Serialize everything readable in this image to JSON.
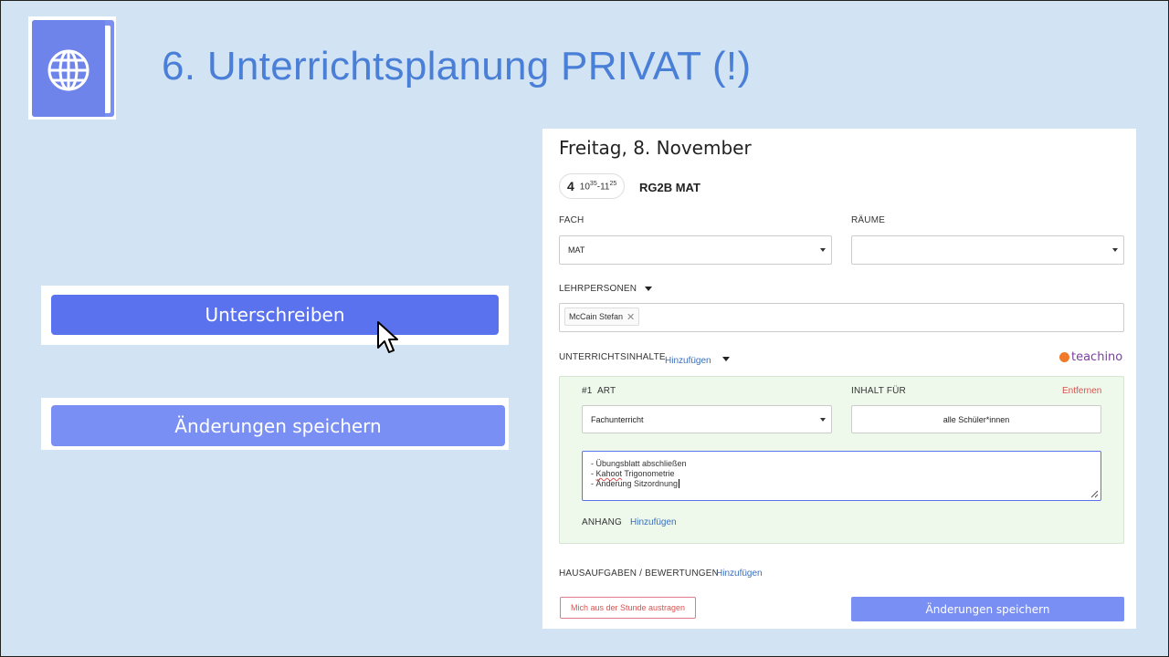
{
  "slide": {
    "title": "6. Unterrichtsplanung PRIVAT (!)",
    "colors": {
      "background": "#d2e3f3",
      "title": "#4a7fd8",
      "accent": "#5b72ee"
    }
  },
  "left_buttons": {
    "sign_label": "Unterschreiben",
    "save_label": "Änderungen speichern"
  },
  "panel": {
    "date": "Freitag, 8. November",
    "period": {
      "number": "4",
      "start_h": "10",
      "start_m": "35",
      "sep": "-",
      "end_h": "11",
      "end_m": "25"
    },
    "class_label": "RG2B MAT",
    "fach_label": "FACH",
    "fach_value": "MAT",
    "raeume_label": "RÄUME",
    "raeume_value": "",
    "lehrpersonen_label": "LEHRPERSONEN",
    "teacher_chip": "McCain Stefan",
    "chip_remove": "✕",
    "unterrichtsinhalte_label": "UNTERRICHTSINHALTE",
    "add_link": "Hinzufügen",
    "brand": "teachino",
    "content": {
      "index": "#1",
      "art_label": "ART",
      "inhalt_label": "INHALT FÜR",
      "remove_link": "Entfernen",
      "art_value": "Fachunterricht",
      "inhalt_value": "alle Schüler*innen",
      "notes": [
        "- Übungsblatt abschließen",
        "- Kahoot Trigonometrie",
        "- Änderung Sitzordnung"
      ],
      "anhang_label": "ANHANG",
      "anhang_link": "Hinzufügen"
    },
    "hausaufgaben_label": "HAUSAUFGABEN / BEWERTUNGEN",
    "hausaufgaben_link": "Hinzufügen",
    "unsubscribe_button": "Mich aus der Stunde austragen",
    "save_button": "Änderungen speichern"
  }
}
